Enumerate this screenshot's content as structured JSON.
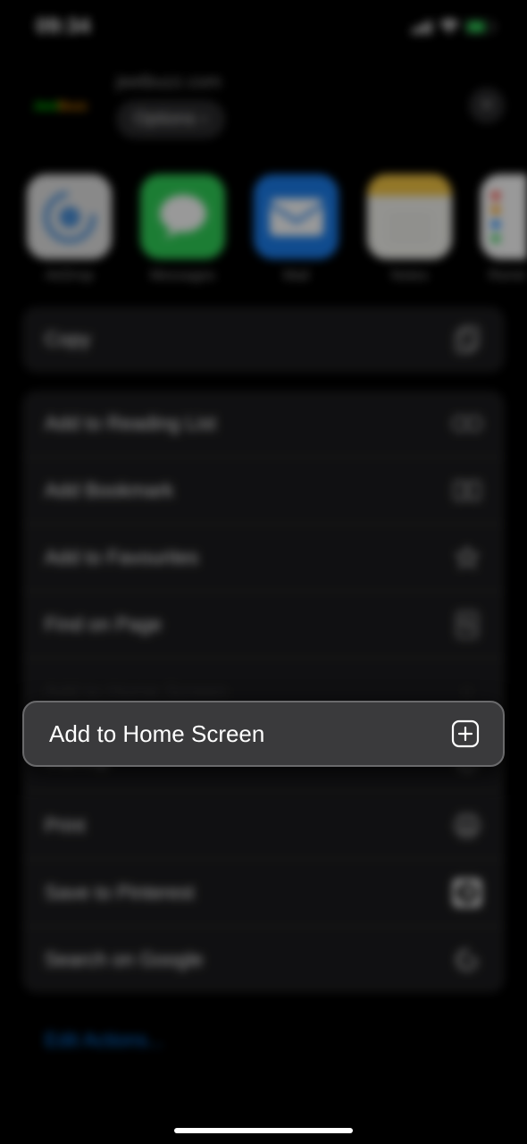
{
  "statusbar": {
    "time": "09:34"
  },
  "header": {
    "url": "jeetbuzz.com",
    "options_label": "Options"
  },
  "apps": {
    "airdrop": "AirDrop",
    "messages": "Messages",
    "mail": "Mail",
    "notes": "Notes",
    "reminders": "Reminders"
  },
  "actions": {
    "copy": "Copy",
    "reading_list": "Add to Reading List",
    "bookmark": "Add Bookmark",
    "favourites": "Add to Favourites",
    "find": "Find on Page",
    "home_screen": "Add to Home Screen",
    "markup": "Markup",
    "print": "Print",
    "pinterest": "Save to Pinterest",
    "google": "Search on Google"
  },
  "edit_actions": "Edit Actions..."
}
